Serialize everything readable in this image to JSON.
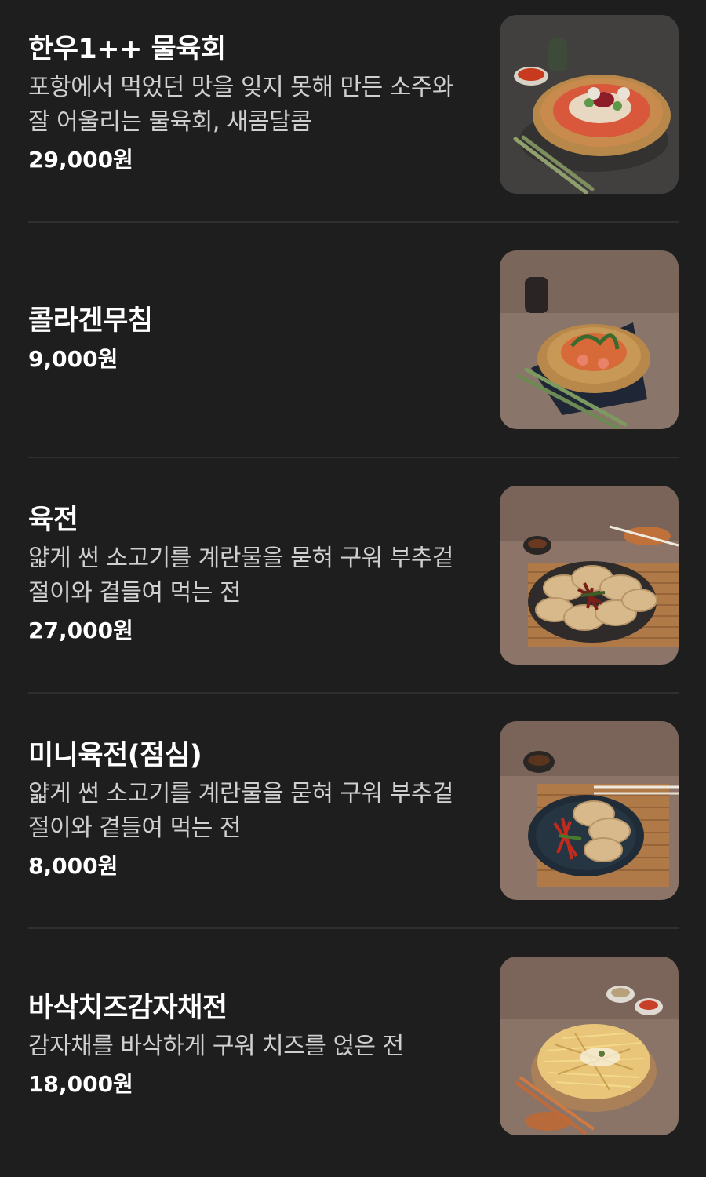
{
  "menu": {
    "items": [
      {
        "name": "한우1++ 물육회",
        "description": "포항에서 먹었던 맛을 잊지 못해 만든 소주와 잘 어울리는 물육회, 새콤달콤",
        "price": "29,000원",
        "photo_icon": "bowl-raw-beef-photo"
      },
      {
        "name": "콜라겐무침",
        "description": "",
        "price": "9,000원",
        "photo_icon": "collagen-salad-photo"
      },
      {
        "name": "육전",
        "description": "얇게 썬 소고기를 계란물을 묻혀 구워 부추겉절이와 곁들여 먹는 전",
        "price": "27,000원",
        "photo_icon": "beef-pancake-photo"
      },
      {
        "name": "미니육전(점심)",
        "description": "얇게 썬 소고기를 계란물을 묻혀 구워 부추겉절이와 곁들여 먹는 전",
        "price": "8,000원",
        "photo_icon": "mini-beef-pancake-photo"
      },
      {
        "name": "바삭치즈감자채전",
        "description": "감자채를 바삭하게 구워 치즈를 얹은 전",
        "price": "18,000원",
        "photo_icon": "potato-cheese-pancake-photo"
      }
    ]
  },
  "colors": {
    "background": "#1e1e1e",
    "text_primary": "#ffffff",
    "text_secondary": "#cfcfcf",
    "divider": "#2f2f2f"
  }
}
